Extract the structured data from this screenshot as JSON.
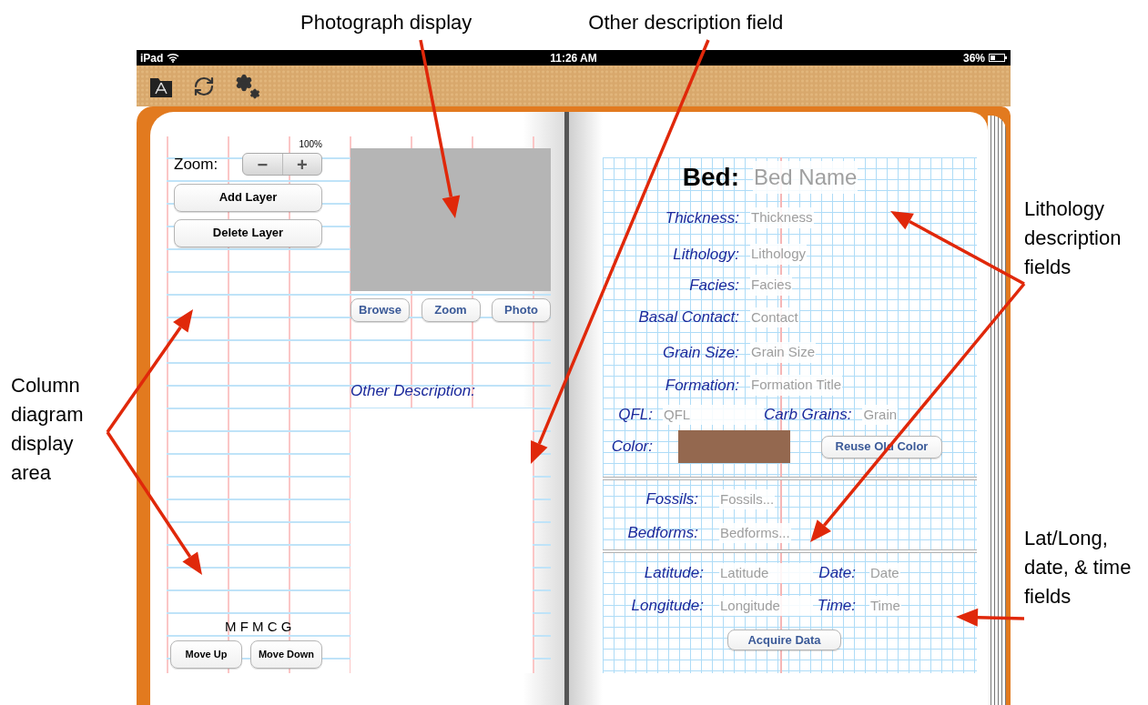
{
  "annotations": {
    "top": [
      "Photograph display",
      "Other description field"
    ],
    "left": [
      "Column diagram display area"
    ],
    "right": [
      "Lithology description fields",
      "Lat/Long, date, & time fields"
    ]
  },
  "status_bar": {
    "device": "iPad",
    "time": "11:26 AM",
    "battery": "36%"
  },
  "left_page": {
    "zoom_percent": "100%",
    "zoom_label": "Zoom:",
    "zoom_buttons": [
      "−",
      "+"
    ],
    "layer_buttons": [
      "Add Layer",
      "Delete Layer"
    ],
    "photo_buttons": [
      "Browse",
      "Zoom",
      "Photo"
    ],
    "other_description_label": "Other Description:",
    "grain_scale": "M F M C G",
    "move_buttons": [
      "Move Up",
      "Move Down"
    ]
  },
  "right_page": {
    "bed_label": "Bed:",
    "bed_placeholder": "Bed Name",
    "fields": [
      {
        "label": "Thickness:",
        "placeholder": "Thickness"
      },
      {
        "label": "Lithology:",
        "placeholder": "Lithology"
      },
      {
        "label": "Facies:",
        "placeholder": "Facies"
      },
      {
        "label": "Basal Contact:",
        "placeholder": "Contact"
      },
      {
        "label": "Grain Size:",
        "placeholder": "Grain Size"
      },
      {
        "label": "Formation:",
        "placeholder": "Formation Title"
      }
    ],
    "qfl": {
      "label": "QFL:",
      "placeholder": "QFL"
    },
    "carb_grains": {
      "label": "Carb Grains:",
      "placeholder": "Grain"
    },
    "color": {
      "label": "Color:",
      "button": "Reuse Old Color"
    },
    "extra_fields": [
      {
        "label": "Fossils:",
        "placeholder": "Fossils..."
      },
      {
        "label": "Bedforms:",
        "placeholder": "Bedforms..."
      }
    ],
    "location": {
      "latitude": {
        "label": "Latitude:",
        "placeholder": "Latitude"
      },
      "date": {
        "label": "Date:",
        "placeholder": "Date"
      },
      "longitude": {
        "label": "Longitude:",
        "placeholder": "Longitude"
      },
      "time": {
        "label": "Time:",
        "placeholder": "Time"
      },
      "button": "Acquire Data"
    }
  }
}
